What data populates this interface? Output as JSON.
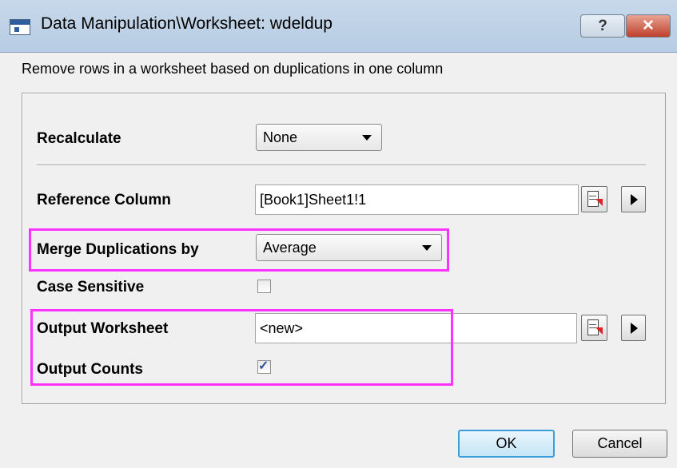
{
  "window": {
    "title": "Data Manipulation\\Worksheet: wdeldup",
    "help_label": "?",
    "close_label": "✕"
  },
  "description": "Remove rows in a worksheet based on duplications in one column",
  "form": {
    "recalculate": {
      "label": "Recalculate",
      "value": "None"
    },
    "reference_column": {
      "label": "Reference Column",
      "value": "[Book1]Sheet1!1"
    },
    "merge_duplications": {
      "label": "Merge Duplications by",
      "value": "Average"
    },
    "case_sensitive": {
      "label": "Case Sensitive",
      "checked": false
    },
    "output_worksheet": {
      "label": "Output Worksheet",
      "value": "<new>"
    },
    "output_counts": {
      "label": "Output Counts",
      "checked": true
    }
  },
  "buttons": {
    "ok": "OK",
    "cancel": "Cancel"
  },
  "colors": {
    "highlight": "#ff33ff",
    "titlebar": "#c7d8ea",
    "dialog": "#f0f0f0"
  }
}
